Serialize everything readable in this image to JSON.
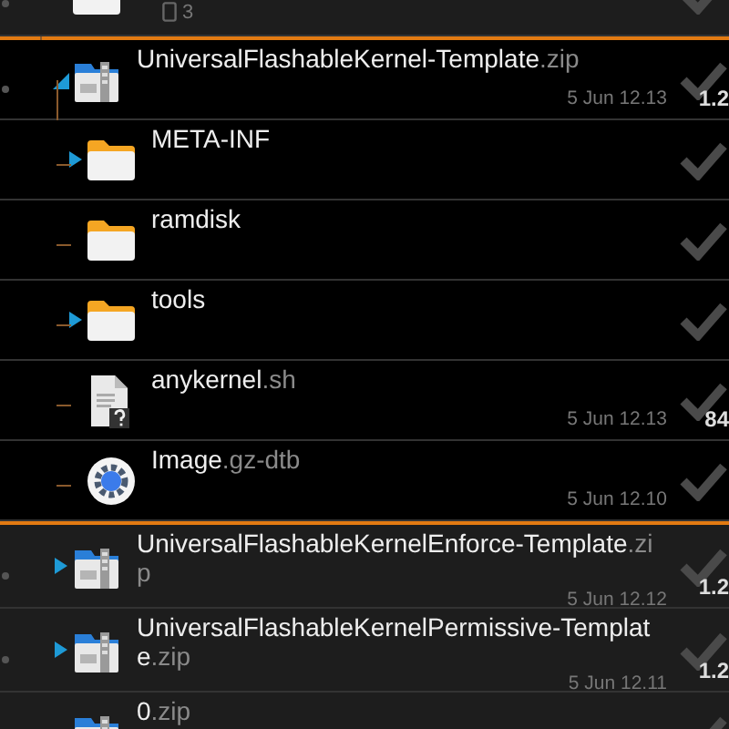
{
  "files": [
    {
      "kind": "folder",
      "count": "3",
      "checked": false,
      "selected": false
    },
    {
      "kind": "zip",
      "name": "UniversalFlashableKernel-Template",
      "ext": ".zip",
      "date": "5 Jun 12.13",
      "size": "1.2",
      "checked": false,
      "selected": true,
      "expanded": true,
      "children": [
        {
          "kind": "folder",
          "name": "META-INF",
          "checked": false,
          "expanded": false
        },
        {
          "kind": "folder",
          "name": "ramdisk",
          "checked": false
        },
        {
          "kind": "folder",
          "name": "tools",
          "checked": false,
          "expanded": false
        },
        {
          "kind": "script",
          "name": "anykernel",
          "ext": ".sh",
          "date": "5 Jun 12.13",
          "size": "84",
          "checked": false
        },
        {
          "kind": "gear",
          "name": "Image",
          "ext": ".gz-dtb",
          "date": "5 Jun 12.10",
          "checked": false
        }
      ]
    },
    {
      "kind": "zip",
      "name": "UniversalFlashableKernelEnforce-Template",
      "ext": ".zip",
      "date": "5 Jun 12.12",
      "size": "1.2",
      "checked": false,
      "selected": false,
      "expanded": false
    },
    {
      "kind": "zip",
      "name": "UniversalFlashableKernelPermissive-Template",
      "ext": ".zip",
      "date": "5 Jun 12.11",
      "size": "1.2",
      "checked": false,
      "selected": false,
      "expanded": false
    },
    {
      "kind": "zip",
      "name": "0",
      "ext": ".zip",
      "checked": false,
      "selected": false
    }
  ]
}
